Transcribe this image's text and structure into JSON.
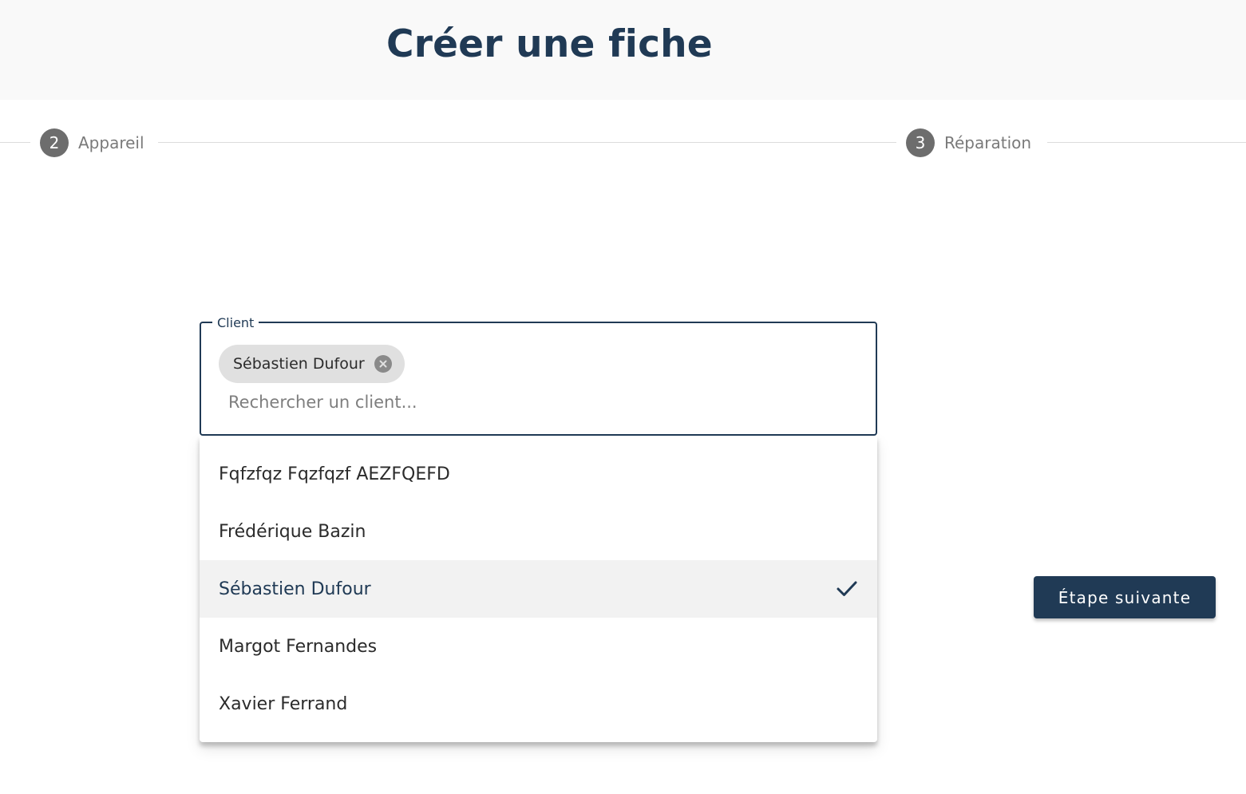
{
  "header": {
    "title": "Créer une fiche"
  },
  "stepper": {
    "steps": [
      {
        "number": "2",
        "label": "Appareil"
      },
      {
        "number": "3",
        "label": "Réparation"
      }
    ]
  },
  "client_field": {
    "label": "Client",
    "selected_chip": "Sébastien Dufour",
    "search_placeholder": "Rechercher un client...",
    "search_value": ""
  },
  "dropdown": {
    "options": [
      {
        "label": "Fqfzfqz Fqzfqzf AEZFQEFD",
        "selected": false
      },
      {
        "label": "Frédérique Bazin",
        "selected": false
      },
      {
        "label": "Sébastien Dufour",
        "selected": true
      },
      {
        "label": "Margot Fernandes",
        "selected": false
      },
      {
        "label": "Xavier Ferrand",
        "selected": false
      }
    ]
  },
  "actions": {
    "next_label": "Étape suivante"
  },
  "colors": {
    "primary": "#203a55",
    "header_bg": "#f9f9f9",
    "step_circle": "#6d6d6d",
    "chip_bg": "#e0e0e0",
    "selected_option_bg": "#f2f2f2"
  },
  "icons": {
    "chip_remove": "close-circle-icon",
    "selected_option": "check-icon"
  }
}
